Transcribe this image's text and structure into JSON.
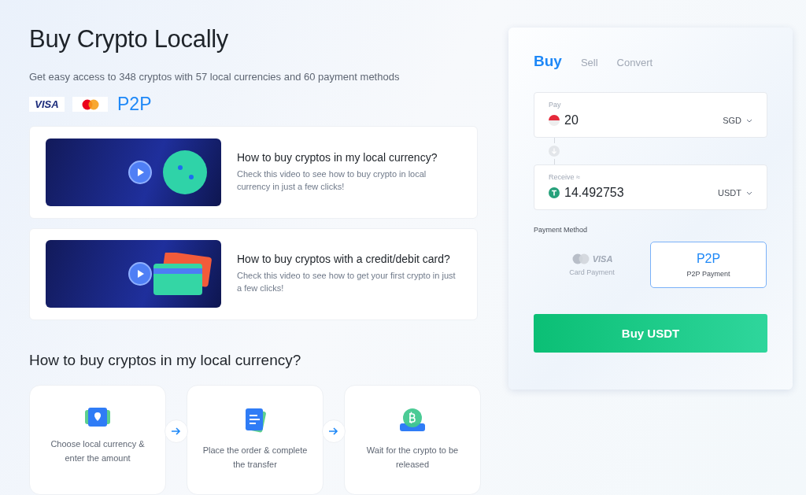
{
  "hero": {
    "title": "Buy Crypto Locally",
    "subtitle": "Get easy access to 348 cryptos with 57 local currencies and 60 payment methods"
  },
  "payment_logos": [
    {
      "kind": "visa",
      "label": "VISA"
    },
    {
      "kind": "mastercard"
    },
    {
      "kind": "p2p",
      "label": "P2P"
    }
  ],
  "videos": [
    {
      "kind": "globe",
      "title": "How to buy cryptos in my local currency?",
      "description": "Check this video to see how to buy crypto in local currency in just a few clicks!"
    },
    {
      "kind": "cards",
      "title": "How to buy cryptos with a credit/debit card?",
      "description": "Check this video to see how to get your first crypto in just a few clicks!"
    }
  ],
  "steps_section": {
    "title": "How to buy cryptos in my local currency?",
    "steps": [
      {
        "kind": "location",
        "label": "Choose local currency & enter the amount"
      },
      {
        "kind": "order",
        "label": "Place the order & complete the transfer"
      },
      {
        "kind": "coin",
        "label": "Wait for the crypto to be released"
      }
    ]
  },
  "trade_card": {
    "tabs": [
      {
        "label": "Buy",
        "selected": true
      },
      {
        "label": "Sell",
        "selected": false
      },
      {
        "label": "Convert",
        "selected": false
      }
    ],
    "pay": {
      "label": "Pay",
      "value": "20",
      "currency": "SGD"
    },
    "receive": {
      "label": "Receive ≈",
      "value": "14.492753",
      "currency": "USDT"
    },
    "payment_method_label": "Payment Method",
    "payment_methods": [
      {
        "kind": "card",
        "logo": "VISA",
        "label": "Card Payment",
        "selected": false
      },
      {
        "kind": "p2p",
        "logo": "P2P",
        "label": "P2P Payment",
        "selected": true
      }
    ],
    "submit": "Buy USDT"
  }
}
